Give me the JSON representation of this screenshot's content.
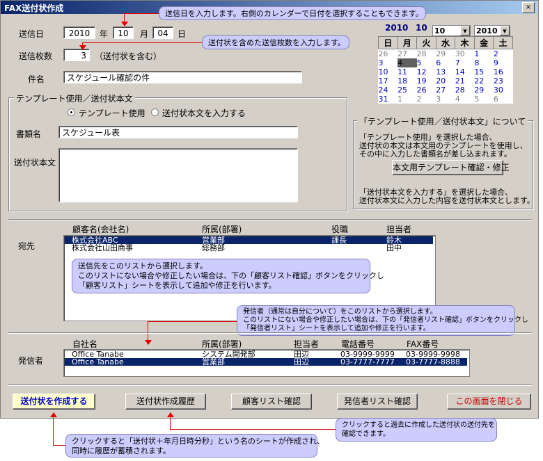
{
  "window": {
    "title": "FAX送付状作成",
    "close_glyph": "×"
  },
  "date_section": {
    "label": "送信日",
    "year": "2010",
    "year_unit": "年",
    "month": "10",
    "month_unit": "月",
    "day": "04",
    "day_unit": "日"
  },
  "pages": {
    "label": "送信枚数",
    "value": "3",
    "note": "（送付状を含む）"
  },
  "subject": {
    "label": "件名",
    "value": "スケジュール確認の件"
  },
  "template_group": {
    "legend": "テンプレート使用／送付状本文",
    "radio_template": "テンプレート使用",
    "radio_body": "送付状本文を入力する",
    "doc_label": "書類名",
    "doc_value": "スケジュール表",
    "body_label": "送付状本文",
    "body_value": ""
  },
  "calendar": {
    "year": "2010",
    "month": "10",
    "month_combo": "10",
    "year_combo": "2010",
    "weekdays": [
      "日",
      "月",
      "火",
      "水",
      "木",
      "金",
      "土"
    ],
    "weeks": [
      [
        "26",
        "27",
        "28",
        "29",
        "30",
        "1",
        "2"
      ],
      [
        "3",
        "4",
        "5",
        "6",
        "7",
        "8",
        "9"
      ],
      [
        "10",
        "11",
        "12",
        "13",
        "14",
        "15",
        "16"
      ],
      [
        "17",
        "18",
        "19",
        "20",
        "21",
        "22",
        "23"
      ],
      [
        "24",
        "25",
        "26",
        "27",
        "28",
        "29",
        "30"
      ],
      [
        "31",
        "1",
        "2",
        "3",
        "4",
        "5",
        "6"
      ]
    ]
  },
  "info_group": {
    "legend": "「テンプレート使用／送付状本文」について",
    "text1": "「テンプレート使用」を選択した場合、",
    "text2": "送付状の本文は本文用のテンプレートを使用し、",
    "text3": "その中に入力した書類名が差し込まれます。",
    "button": "本文用テンプレート確認・修正",
    "text4": "「送付状本文を入力する」を選択した場合、",
    "text5": "送付状本文に入力した内容を送付状本文とします。"
  },
  "recipient": {
    "label": "宛先",
    "headers": [
      "顧客名(会社名)",
      "所属(部署)",
      "役職",
      "担当者"
    ],
    "rows": [
      [
        "株式会社ABC",
        "営業部",
        "課長",
        "鈴木"
      ],
      [
        "株式会社山田商事",
        "総務部",
        "",
        "田中"
      ]
    ]
  },
  "sender": {
    "label": "発信者",
    "headers": [
      "自社名",
      "所属(部署)",
      "担当者",
      "電話番号",
      "FAX番号"
    ],
    "rows": [
      [
        "Office Tanabe",
        "システム開発部",
        "田辺",
        "03-9999-9999",
        "03-9999-9998"
      ],
      [
        "Office Tanabe",
        "営業部",
        "田辺",
        "03-7777-7777",
        "03-7777-8888"
      ]
    ]
  },
  "buttons": {
    "create": "送付状を作成する",
    "history": "送付状作成履歴",
    "customer": "顧客リスト確認",
    "sender_list": "発信者リスト確認",
    "close": "この画面を閉じる"
  },
  "callouts": {
    "date": "送信日を入力します。右側のカレンダーで日付を選択することもできます。",
    "pages": "送付状を含めた送信枚数を入力します。",
    "recipient1": "送信先をこのリストから選択します。",
    "recipient2": "このリストにない場合や修正したい場合は、下の「顧客リスト確認」ボタンをクリックし",
    "recipient3": "「顧客リスト」シートを表示して追加や修正を行います。",
    "sender1": "発信者（通常は自分について）をこのリストから選択します。",
    "sender2": "このリストにない場合や修正したい場合は、下の「発信者リスト確認」ボタンをクリックし",
    "sender3": "「発信者リスト」シートを表示して追加や修正を行います。",
    "history1": "クリックすると過去に作成した送付状の送付先を",
    "history2": "確認できます。",
    "create1": "クリックすると「送付状＋年月日時分秒」という名のシートが作成され、",
    "create2": "同時に履歴が蓄積されます。"
  }
}
